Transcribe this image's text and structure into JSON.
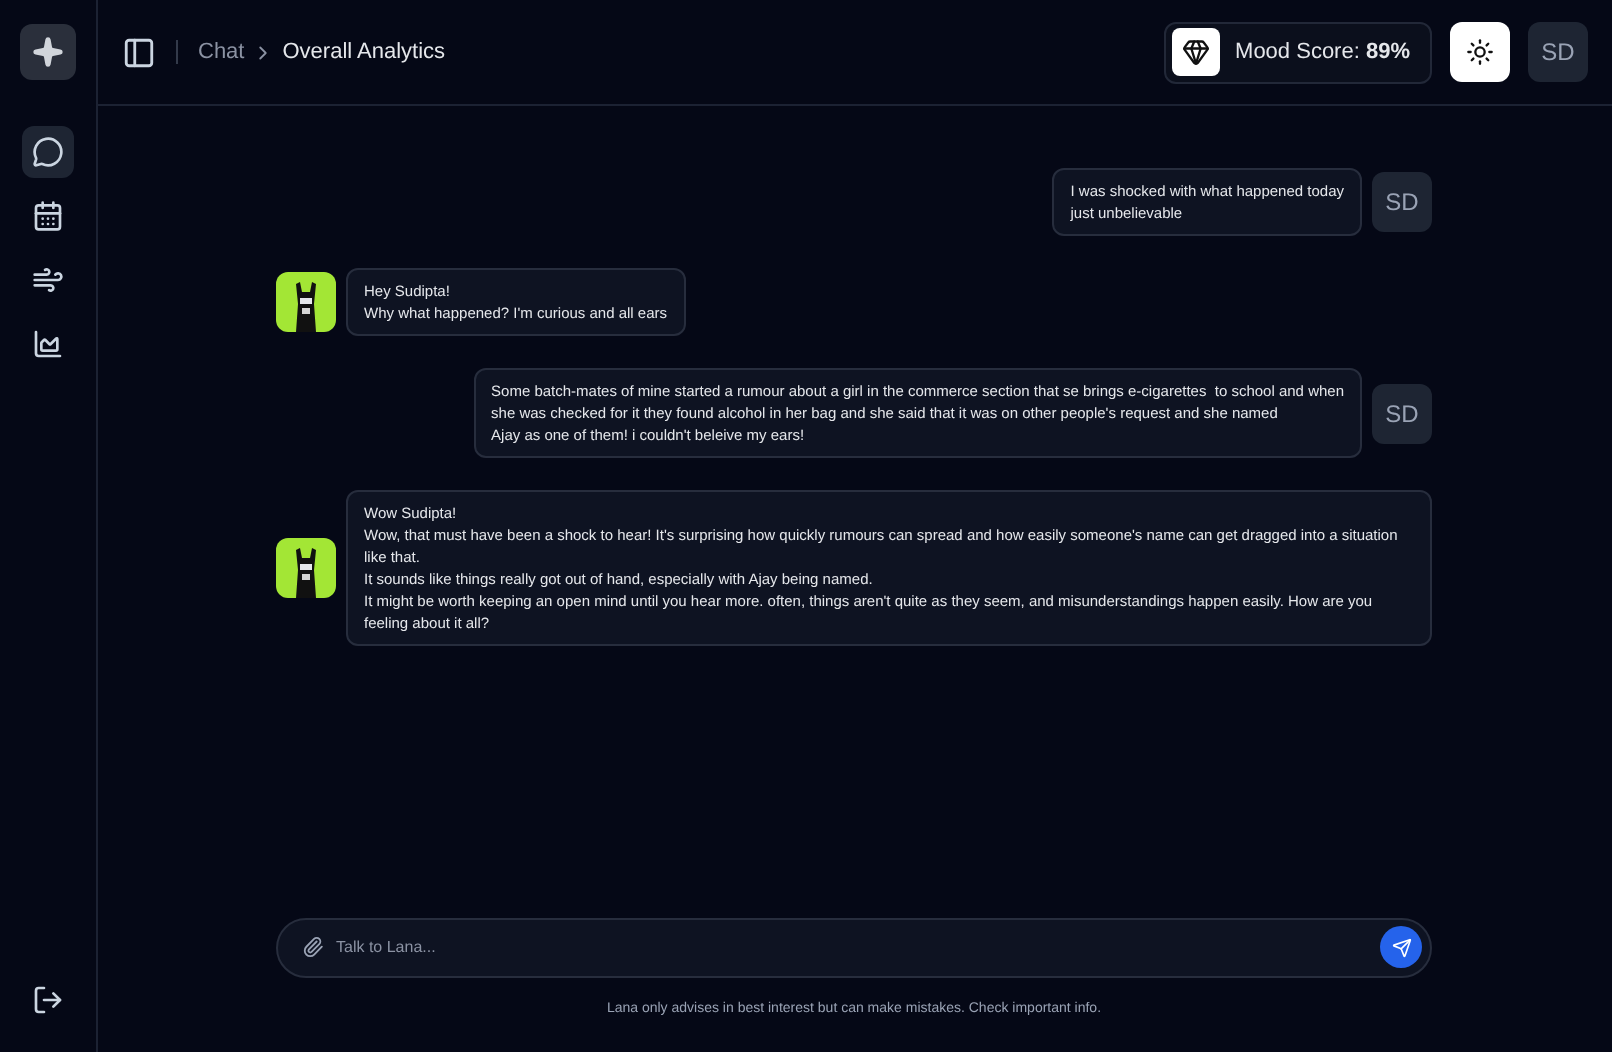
{
  "sidebar": {
    "items": [
      {
        "selected": true
      },
      {
        "selected": false
      },
      {
        "selected": false
      },
      {
        "selected": false
      }
    ]
  },
  "header": {
    "breadcrumb": [
      "Chat",
      "Overall Analytics"
    ],
    "mood_label": "Mood Score:",
    "mood_value": "89%",
    "user_initials": "SD"
  },
  "messages": [
    {
      "kind": "user",
      "initials": "SD",
      "lines": [
        "I was shocked with what happened today",
        "just unbelievable"
      ]
    },
    {
      "kind": "bot",
      "lines": [
        "Hey Sudipta!",
        "Why what happened? I'm curious and all ears"
      ]
    },
    {
      "kind": "user",
      "initials": "SD",
      "lines": [
        "Some batch-mates of mine started a rumour about a girl in the commerce section that se brings e-cigarettes  to school and when",
        "she was checked for it they found alcohol in her bag and she said that it was on other people's request and she named",
        "Ajay as one of them! i couldn't beleive my ears!"
      ]
    },
    {
      "kind": "bot",
      "lines": [
        "Wow Sudipta!",
        "Wow, that must have been a shock to hear! It's surprising how quickly rumours can spread and how easily someone's name can get dragged into a situation like that.",
        "It sounds like things really got out of hand, especially with Ajay being named.",
        "It might be worth keeping an open mind until you hear more. often, things aren't quite as they seem, and misunderstandings happen easily. How are you feeling about it all?"
      ]
    }
  ],
  "composer": {
    "placeholder": "Talk to Lana..."
  },
  "disclaimer": "Lana only advises in best interest but can make mistakes. Check important info."
}
